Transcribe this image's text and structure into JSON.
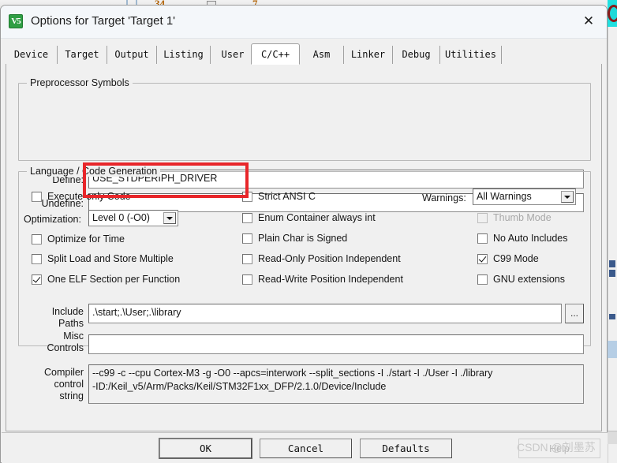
{
  "background": {
    "toolbar_items": [
      "34",
      "7"
    ],
    "icon_name": "stop-icon"
  },
  "window": {
    "title": "Options for Target 'Target 1'",
    "app_icon": "keil-uvision5-icon",
    "app_icon_text": "V5",
    "close_icon": "close-icon",
    "close_glyph": "✕"
  },
  "tabs": [
    {
      "label": "Device",
      "active": false
    },
    {
      "label": "Target",
      "active": false
    },
    {
      "label": "Output",
      "active": false
    },
    {
      "label": "Listing",
      "active": false
    },
    {
      "label": "User",
      "active": false
    },
    {
      "label": "C/C++",
      "active": true
    },
    {
      "label": "Asm",
      "active": false
    },
    {
      "label": "Linker",
      "active": false
    },
    {
      "label": "Debug",
      "active": false
    },
    {
      "label": "Utilities",
      "active": false
    }
  ],
  "preprocessor": {
    "group_label": "Preprocessor Symbols",
    "define_label": "Define:",
    "define_value": "USE_STDPERIPH_DRIVER",
    "undefine_label": "Undefine:",
    "undefine_value": ""
  },
  "language": {
    "group_label": "Language / Code Generation",
    "left_column": [
      {
        "label": "Execute-only Code",
        "checked": false,
        "disabled": false
      },
      {
        "label": "Optimize for Time",
        "checked": false,
        "disabled": false
      },
      {
        "label": "Split Load and Store Multiple",
        "checked": false,
        "disabled": false
      },
      {
        "label": "One ELF Section per Function",
        "checked": true,
        "disabled": false
      }
    ],
    "optimization_label": "Optimization:",
    "optimization_value": "Level 0 (-O0)",
    "middle_column": [
      {
        "label": "Strict ANSI C",
        "checked": false,
        "disabled": false
      },
      {
        "label": "Enum Container always int",
        "checked": false,
        "disabled": false
      },
      {
        "label": "Plain Char is Signed",
        "checked": false,
        "disabled": false
      },
      {
        "label": "Read-Only Position Independent",
        "checked": false,
        "disabled": false
      },
      {
        "label": "Read-Write Position Independent",
        "checked": false,
        "disabled": false
      }
    ],
    "warnings_label": "Warnings:",
    "warnings_value": "All Warnings",
    "right_column": [
      {
        "label": "Thumb Mode",
        "checked": false,
        "disabled": true
      },
      {
        "label": "No Auto Includes",
        "checked": false,
        "disabled": false
      },
      {
        "label": "C99 Mode",
        "checked": true,
        "disabled": false
      },
      {
        "label": "GNU extensions",
        "checked": false,
        "disabled": false
      }
    ]
  },
  "paths": {
    "include_label_line1": "Include",
    "include_label_line2": "Paths",
    "include_value": ".\\start;.\\User;.\\library",
    "browse_label": "...",
    "misc_label_line1": "Misc",
    "misc_label_line2": "Controls",
    "misc_value": "",
    "compiler_label_line1": "Compiler",
    "compiler_label_line2": "control",
    "compiler_label_line3": "string",
    "compiler_value": "--c99 -c --cpu Cortex-M3 -g -O0 --apcs=interwork --split_sections -I ./start -I ./User -I ./library\n-ID:/Keil_v5/Arm/Packs/Keil/STM32F1xx_DFP/2.1.0/Device/Include"
  },
  "buttons": {
    "ok": "OK",
    "cancel": "Cancel",
    "defaults": "Defaults",
    "help": "Help"
  },
  "annotation": {
    "highlight_color": "#e8262a"
  },
  "watermark": {
    "text": "CSDN @刘墨苏"
  }
}
